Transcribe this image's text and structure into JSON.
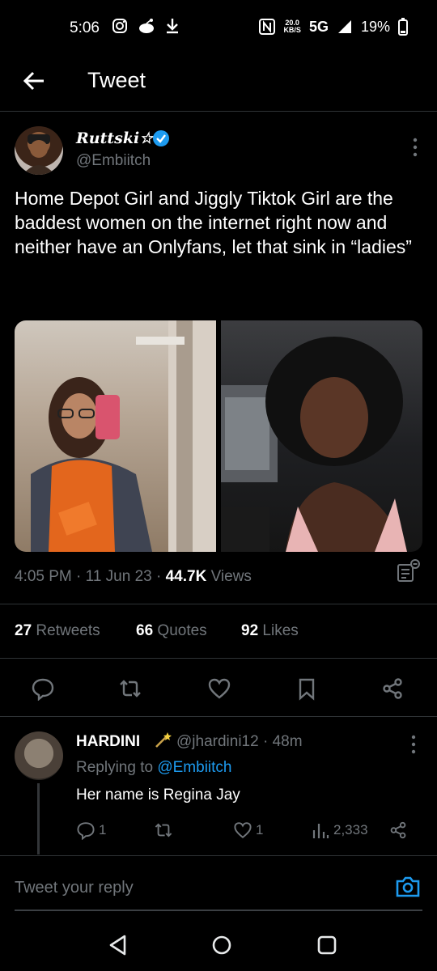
{
  "status": {
    "time": "5:06",
    "kbs_top": "20.0",
    "kbs_bottom": "KB/S",
    "network": "5G",
    "battery": "19%"
  },
  "header": {
    "title": "Tweet"
  },
  "tweet": {
    "author_name": "Ruttski☆",
    "author_handle": "@Embiitch",
    "text": "Home Depot Girl and Jiggly Tiktok Girl are the baddest women on the internet right now and neither have an Onlyfans, let that sink in “ladies”",
    "time": "4:05 PM",
    "date": "11 Jun 23",
    "views_count": "44.7K",
    "views_label": "Views",
    "retweets_count": "27",
    "retweets_label": "Retweets",
    "quotes_count": "66",
    "quotes_label": "Quotes",
    "likes_count": "92",
    "likes_label": "Likes"
  },
  "reply": {
    "name": "HARDINI",
    "handle_time": "@jhardini12 · 48m",
    "replying_label": "Replying to",
    "replying_to": "@Embiitch",
    "text": "Her name is Regina Jay",
    "replies": "1",
    "likes": "1",
    "views": "2,333"
  },
  "composer": {
    "placeholder": "Tweet your reply"
  },
  "colors": {
    "accent": "#1d9bf0",
    "muted": "#71767b",
    "divider": "#2f3336"
  }
}
